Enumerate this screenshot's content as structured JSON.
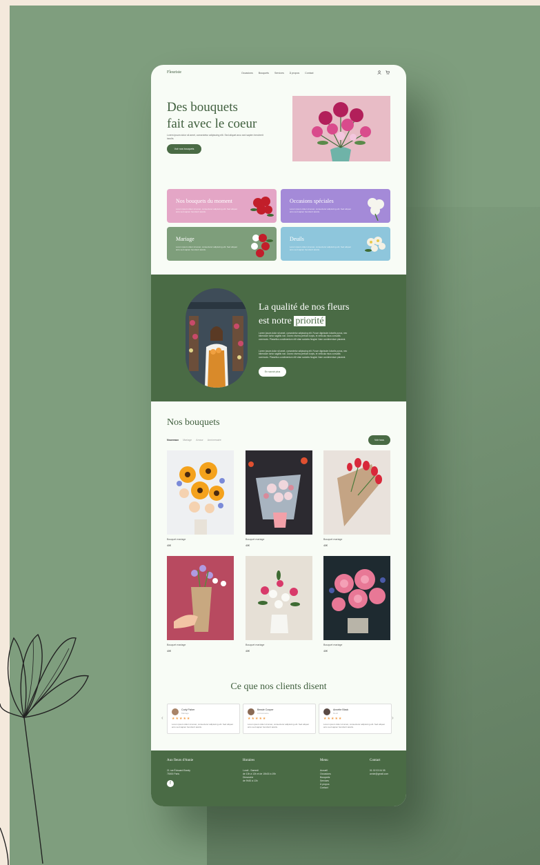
{
  "nav": {
    "logo": "Fleuriste",
    "links": [
      "Occasions",
      "Bouquets",
      "Services",
      "À propos",
      "Contact"
    ],
    "icons": [
      "user-icon",
      "cart-icon"
    ]
  },
  "hero": {
    "title_line1": "Des bouquets",
    "title_line2": "fait avec le coeur",
    "text": "Lorem ipsum dolor sit amet, consectetur adipiscing elit. Sed aliquet arcu sed sapien hendrerit iaculis.",
    "button": "Voir nos bouquets"
  },
  "categories": [
    {
      "title": "Nos bouquets du moment",
      "desc": "Lorem ipsum dolor sit amet, consectetur adipiscing elit. Sed aliquet arcu sed sapien hendrerit iaculis.",
      "color": "#e4a6c6"
    },
    {
      "title": "Occasions spéciales",
      "desc": "Lorem ipsum dolor sit amet, consectetur adipiscing elit. Sed aliquet arcu sed sapien hendrerit iaculis.",
      "color": "#a48ad8"
    },
    {
      "title": "Mariage",
      "desc": "Lorem ipsum dolor sit amet, consectetur adipiscing elit. Sed aliquet arcu sed sapien hendrerit iaculis.",
      "color": "#7e9e7b"
    },
    {
      "title": "Deuils",
      "desc": "Lorem ipsum dolor sit amet, consectetur adipiscing elit. Sed aliquet arcu sed sapien hendrerit iaculis.",
      "color": "#8ec6dc"
    }
  ],
  "quality": {
    "title_part1": "La qualité de nos fleurs",
    "title_part2": "est notre",
    "highlight": "priorité",
    "p1": "Lorem ipsum dolor sit amet, consectetur adipiscing elit. Fusce dignissim lobortis purus, nec bibendum tortor sagittis non. Donec viverra pretium turpis, et vehicula risus convallis commodo. Phasellus condimentum elit vitae sodales feugiat. Nam condimentum placerat.",
    "p2": "Lorem ipsum dolor sit amet, consectetur adipiscing elit. Fusce dignissim lobortis purus, nec bibendum tortor sagittis non. Donec viverra pretium turpis, et vehicula risus convallis commodo. Phasellus condimentum elit vitae sodales feugiat. Nam condimentum placerat.",
    "button": "En savoir plus"
  },
  "bouquets": {
    "title": "Nos bouquets",
    "filters": [
      "Nouveaux",
      "Mariage",
      "Amour",
      "Anniversaire"
    ],
    "see_all": "Voir tous",
    "items": [
      {
        "name": "Bouquet mariage",
        "price": "40€"
      },
      {
        "name": "Bouquet mariage",
        "price": "40€"
      },
      {
        "name": "Bouquet mariage",
        "price": "40€"
      },
      {
        "name": "Bouquet mariage",
        "price": "40€"
      },
      {
        "name": "Bouquet mariage",
        "price": "40€"
      },
      {
        "name": "Bouquet mariage",
        "price": "40€"
      }
    ]
  },
  "testimonials": {
    "title": "Ce que nos clients disent",
    "items": [
      {
        "name": "Cody Fisher",
        "sub": "Mariage",
        "stars": "★★★★★",
        "text": "Lorem ipsum dolor sit amet, consectetur adipiscing elit. Sed aliquet arcu sed sapien hendrerit iaculis."
      },
      {
        "name": "Bessie Cooper",
        "sub": "Anniversaire",
        "stars": "★★★★★",
        "text": "Lorem ipsum dolor sit amet, consectetur adipiscing elit. Sed aliquet arcu sed sapien hendrerit iaculis."
      },
      {
        "name": "Annette Black",
        "sub": "Deuil",
        "stars": "★★★★★",
        "text": "Lorem ipsum dolor sit amet, consectetur adipiscing elit. Sed aliquet arcu sed sapien hendrerit iaculis."
      }
    ]
  },
  "footer": {
    "brand": "Aux fleurs d'Annie",
    "address1": "21 rue Édouard Branly",
    "address2": "75000 Paris",
    "hours_title": "Horaires",
    "hours1": "Lundi - Samedi",
    "hours2": "de 10h à 13h et de 15h30 à 19h",
    "hours3": "Dimanche",
    "hours4": "de 9h30 à 13h",
    "menu_title": "Menu",
    "menu": [
      "Accueil",
      "Occasions",
      "Bouquets",
      "Services",
      "À propos",
      "Contact"
    ],
    "contact_title": "Contact",
    "phone": "01 02 03 04 05",
    "email": "annie@gmail.com"
  }
}
